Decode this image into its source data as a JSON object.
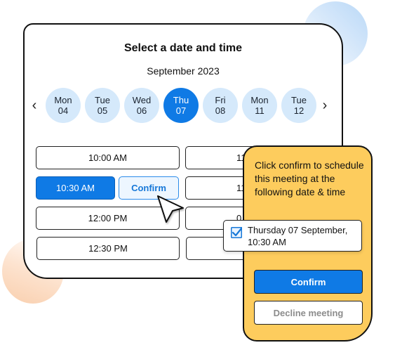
{
  "scheduler": {
    "title": "Select a date and time",
    "month": "September 2023",
    "prev_icon": "chevron-left-icon",
    "next_icon": "chevron-right-icon",
    "prev_glyph": "‹",
    "next_glyph": "›",
    "days": [
      {
        "weekday": "Mon",
        "date": "04",
        "selected": false
      },
      {
        "weekday": "Tue",
        "date": "05",
        "selected": false
      },
      {
        "weekday": "Wed",
        "date": "06",
        "selected": false
      },
      {
        "weekday": "Thu",
        "date": "07",
        "selected": true
      },
      {
        "weekday": "Fri",
        "date": "08",
        "selected": false
      },
      {
        "weekday": "Mon",
        "date": "11",
        "selected": false
      },
      {
        "weekday": "Tue",
        "date": "12",
        "selected": false
      }
    ],
    "slots_left": [
      "10:00 AM",
      "10:30 AM",
      "12:00 PM",
      "12:30 PM"
    ],
    "selected_slot": "10:30 AM",
    "inline_confirm_label": "Confirm",
    "slots_right_visible": [
      "11",
      "11",
      "0",
      ""
    ]
  },
  "confirm_panel": {
    "message": "Click confirm to schedule this meeting at the following date & time",
    "summary_line1": "Thursday 07  September,",
    "summary_line2": "10:30 AM",
    "summary_checked": true,
    "confirm_label": "Confirm",
    "decline_label": "Decline meeting"
  },
  "colors": {
    "accent_blue": "#0f7ae5",
    "day_bubble": "#d5e9fb",
    "panel_yellow": "#fdcc5d"
  }
}
